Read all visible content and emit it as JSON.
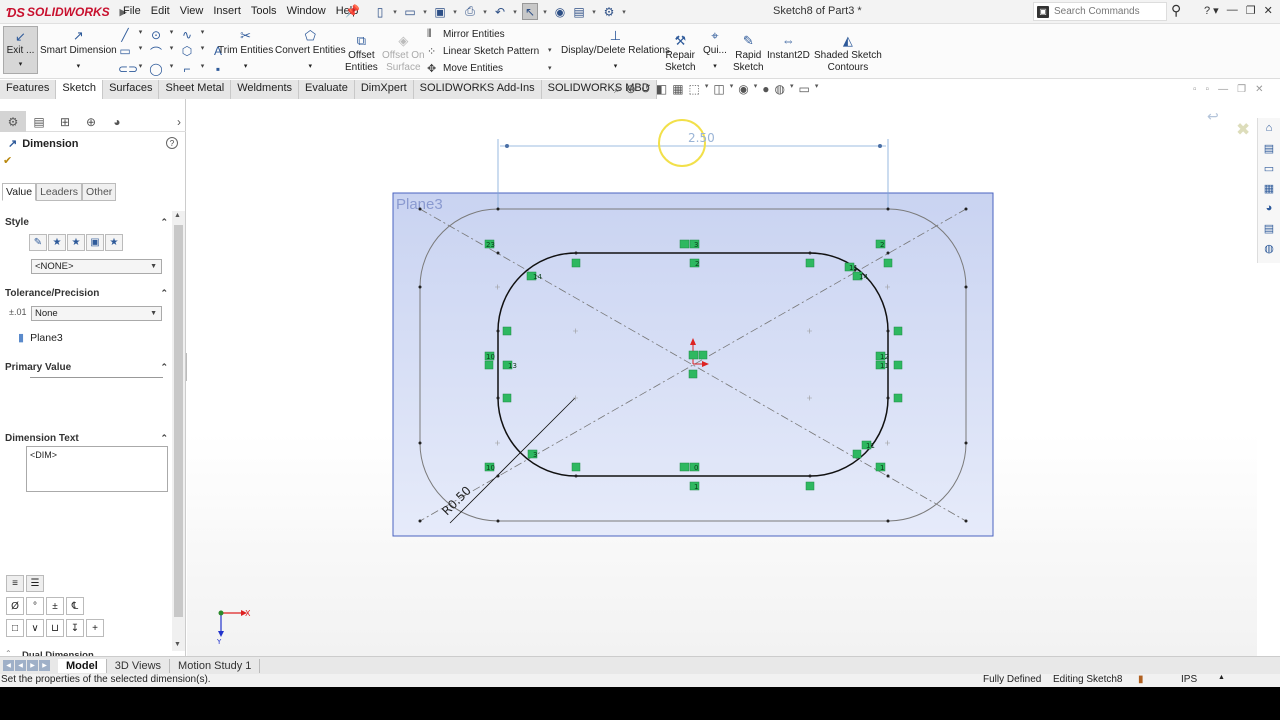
{
  "app": {
    "brand": "SOLIDWORKS",
    "doc_title": "Sketch8 of Part3 *",
    "menus": [
      "File",
      "Edit",
      "View",
      "Insert",
      "Tools",
      "Window",
      "Help"
    ],
    "search_placeholder": "Search Commands",
    "help_label": "?"
  },
  "commands": {
    "exit_sketch": "Exit ...",
    "smart_dimension": "Smart Dimension",
    "trim_entities": "Trim Entities",
    "convert_entities": "Convert Entities",
    "offset_entities": [
      "Offset",
      "Entities"
    ],
    "offset_on_surface": [
      "Offset On",
      "Surface"
    ],
    "mirror_entities": "Mirror Entities",
    "linear_sketch_pattern": "Linear Sketch Pattern",
    "move_entities": "Move Entities",
    "display_delete_relations": "Display/Delete Relations",
    "repair_sketch": [
      "Repair",
      "Sketch"
    ],
    "quick_snaps": "Qui...",
    "rapid_sketch": [
      "Rapid",
      "Sketch"
    ],
    "instant2d": "Instant2D",
    "shaded_sketch_contours": [
      "Shaded Sketch",
      "Contours"
    ]
  },
  "tabs": [
    "Features",
    "Sketch",
    "Surfaces",
    "Sheet Metal",
    "Weldments",
    "Evaluate",
    "DimXpert",
    "SOLIDWORKS Add-Ins",
    "SOLIDWORKS MBD"
  ],
  "active_tab": "Sketch",
  "property_manager": {
    "title": "Dimension",
    "help": "?",
    "subtabs": [
      "Value",
      "Leaders",
      "Other"
    ],
    "groups": {
      "style": "Style",
      "tolerance": "Tolerance/Precision",
      "primary_value": "Primary Value",
      "dimension_text": "Dimension Text",
      "dual_dimension": "Dual Dimension"
    },
    "style_combo": "<NONE>",
    "tolerance_combo": "None",
    "plane_ref": "Plane3",
    "dim_text_value": "<DIM>",
    "symbols_row1": [
      "Ø",
      "°",
      "±",
      "℄"
    ],
    "symbols_row2": [
      "□",
      "∨",
      "⊔",
      "↧",
      "+"
    ]
  },
  "graphics": {
    "plane_label": "Plane3",
    "dimension_value": "2.50",
    "radius_label": "R0.50",
    "triad_x": "X",
    "triad_y": "Y"
  },
  "bottom_tabs": [
    "Model",
    "3D Views",
    "Motion Study 1"
  ],
  "active_bottom_tab": "Model",
  "status": {
    "message": "Set the properties of the selected dimension(s).",
    "definition": "Fully Defined",
    "editing": "Editing Sketch8",
    "units": "IPS"
  },
  "colors": {
    "accent": "#2e5a9a",
    "brand": "#c8102e",
    "plane_fill": "#d5ddf4",
    "relation_marker": "#2eb860",
    "dimension_line": "#7ea7d8"
  }
}
